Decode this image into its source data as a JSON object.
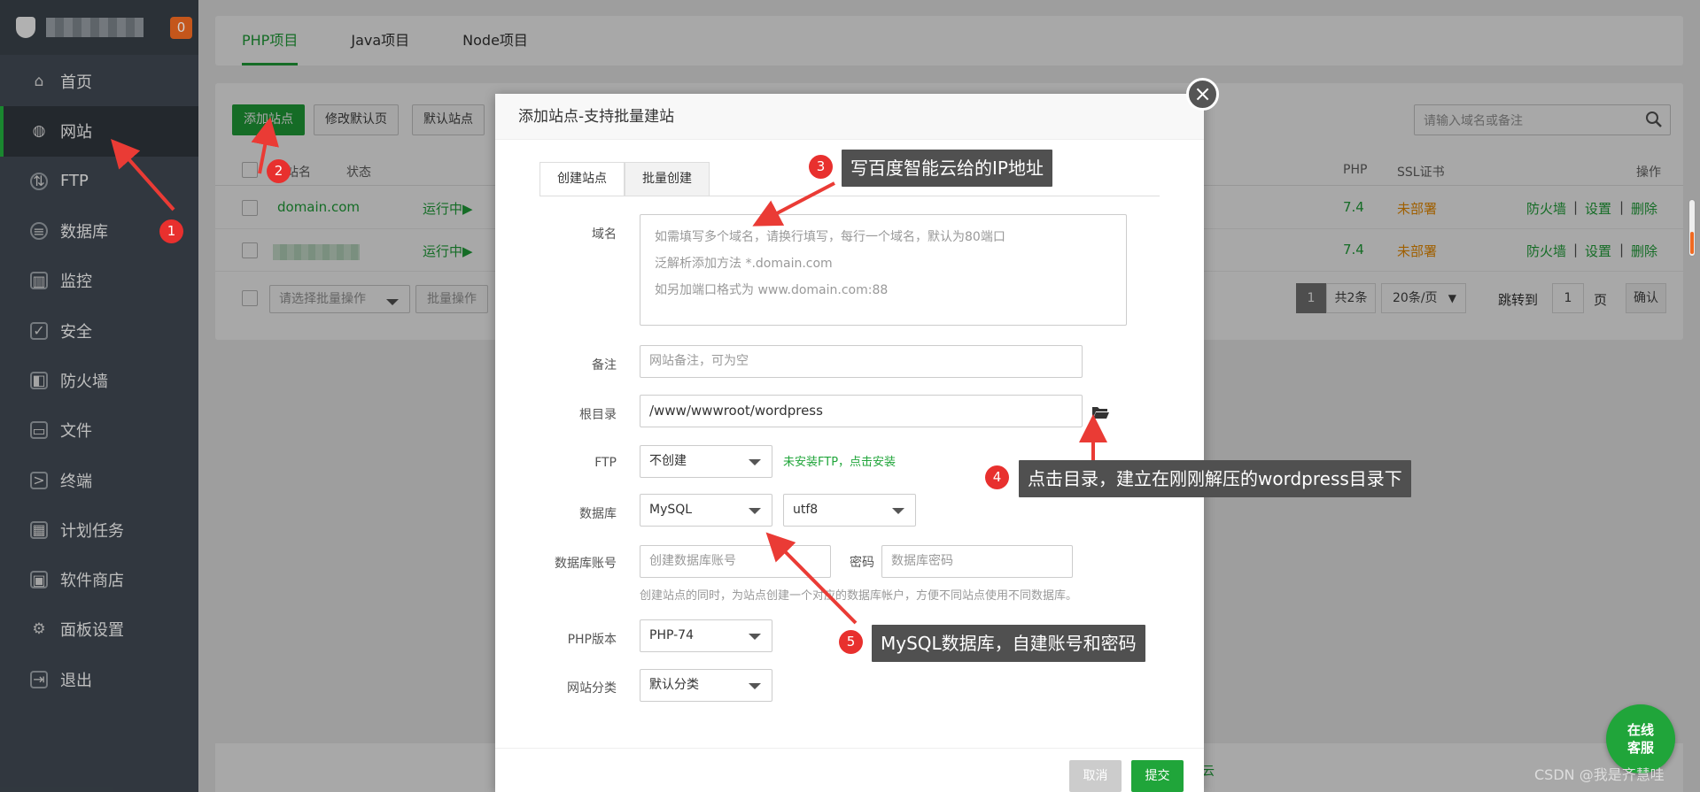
{
  "sidebar": {
    "badge": "0",
    "items": [
      {
        "label": "首页",
        "icon": "home-icon",
        "glyph": "⌂"
      },
      {
        "label": "网站",
        "icon": "globe-icon",
        "glyph": "◍"
      },
      {
        "label": "FTP",
        "icon": "ftp-icon",
        "glyph": "⇅"
      },
      {
        "label": "数据库",
        "icon": "database-icon",
        "glyph": "≡"
      },
      {
        "label": "监控",
        "icon": "monitor-icon",
        "glyph": "▥"
      },
      {
        "label": "安全",
        "icon": "shield-icon",
        "glyph": "✓"
      },
      {
        "label": "防火墙",
        "icon": "firewall-icon",
        "glyph": "◧"
      },
      {
        "label": "文件",
        "icon": "folder-icon",
        "glyph": "▭"
      },
      {
        "label": "终端",
        "icon": "terminal-icon",
        "glyph": ">"
      },
      {
        "label": "计划任务",
        "icon": "calendar-icon",
        "glyph": "▦"
      },
      {
        "label": "软件商店",
        "icon": "apps-icon",
        "glyph": "▣"
      },
      {
        "label": "面板设置",
        "icon": "gear-icon",
        "glyph": "⚙"
      },
      {
        "label": "退出",
        "icon": "logout-icon",
        "glyph": "⇥"
      }
    ]
  },
  "project_tabs": [
    "PHP项目",
    "Java项目",
    "Node项目"
  ],
  "toolbar": {
    "add_site": "添加站点",
    "edit_default_page": "修改默认页",
    "default_site": "默认站点",
    "search_placeholder": "请输入域名或备注"
  },
  "table": {
    "headers": {
      "name": "网站名",
      "status": "状态",
      "php": "PHP",
      "ssl": "SSL证书",
      "actions": "操作"
    },
    "rows": [
      {
        "name": "domain.com",
        "status": "运行中▶",
        "php": "7.4",
        "ssl": "未部署",
        "firewall": "防火墙",
        "settings": "设置",
        "delete": "删除"
      },
      {
        "name": "",
        "status": "运行中▶",
        "php": "7.4",
        "ssl": "未部署",
        "firewall": "防火墙",
        "settings": "设置",
        "delete": "删除"
      }
    ],
    "separator": "|"
  },
  "batch": {
    "select_placeholder": "请选择批量操作",
    "button": "批量操作"
  },
  "pagination": {
    "current": "1",
    "total": "共2条",
    "per_page": "20条/页",
    "jump_label": "跳转到",
    "jump_value": "1",
    "page_unit": "页",
    "confirm": "确认"
  },
  "modal": {
    "title": "添加站点-支持批量建站",
    "close_glyph": "×",
    "tabs": [
      "创建站点",
      "批量创建"
    ],
    "domain": {
      "label": "域名",
      "placeholder_lines": [
        "如需填写多个域名，请换行填写，每行一个域名，默认为80端口",
        "泛解析添加方法 *.domain.com",
        "如另加端口格式为 www.domain.com:88"
      ]
    },
    "remark": {
      "label": "备注",
      "placeholder": "网站备注，可为空"
    },
    "root": {
      "label": "根目录",
      "value": "/www/wwwroot/wordpress"
    },
    "ftp": {
      "label": "FTP",
      "value": "不创建",
      "note": "未安装FTP，点击安装"
    },
    "database": {
      "label": "数据库",
      "type": "MySQL",
      "charset": "utf8"
    },
    "db_account": {
      "label": "数据库账号",
      "placeholder": "创建数据库账号",
      "password_label": "密码",
      "password_placeholder": "数据库密码",
      "hint": "创建站点的同时，为站点创建一个对应的数据库帐户，方便不同站点使用不同数据库。"
    },
    "php_version": {
      "label": "PHP版本",
      "value": "PHP-74"
    },
    "category": {
      "label": "网站分类",
      "value": "默认分类"
    },
    "cancel": "取消",
    "submit": "提交"
  },
  "footer_char": "云",
  "annotations": [
    {
      "num": "1"
    },
    {
      "num": "2"
    },
    {
      "num": "3",
      "text": "写百度智能云给的IP地址"
    },
    {
      "num": "4",
      "text": "点击目录，建立在刚刚解压的wordpress目录下"
    },
    {
      "num": "5",
      "text": "MySQL数据库，自建账号和密码"
    }
  ],
  "chat": {
    "line1": "在线",
    "line2": "客服"
  },
  "watermark": "CSDN @我是齐慧哇",
  "colors": {
    "brand_green": "#20a53a",
    "sidebar_bg": "#3c444d",
    "warning_orange": "#f29000",
    "annotation_red": "#e8302e",
    "callout_bg": "#505050"
  }
}
